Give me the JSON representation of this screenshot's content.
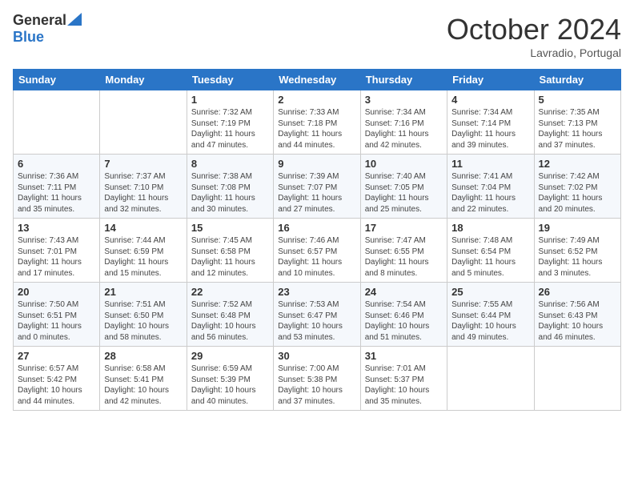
{
  "header": {
    "logo_general": "General",
    "logo_blue": "Blue",
    "month": "October 2024",
    "location": "Lavradio, Portugal"
  },
  "columns": [
    "Sunday",
    "Monday",
    "Tuesday",
    "Wednesday",
    "Thursday",
    "Friday",
    "Saturday"
  ],
  "weeks": [
    [
      {
        "day": "",
        "info": ""
      },
      {
        "day": "",
        "info": ""
      },
      {
        "day": "1",
        "info": "Sunrise: 7:32 AM\nSunset: 7:19 PM\nDaylight: 11 hours and 47 minutes."
      },
      {
        "day": "2",
        "info": "Sunrise: 7:33 AM\nSunset: 7:18 PM\nDaylight: 11 hours and 44 minutes."
      },
      {
        "day": "3",
        "info": "Sunrise: 7:34 AM\nSunset: 7:16 PM\nDaylight: 11 hours and 42 minutes."
      },
      {
        "day": "4",
        "info": "Sunrise: 7:34 AM\nSunset: 7:14 PM\nDaylight: 11 hours and 39 minutes."
      },
      {
        "day": "5",
        "info": "Sunrise: 7:35 AM\nSunset: 7:13 PM\nDaylight: 11 hours and 37 minutes."
      }
    ],
    [
      {
        "day": "6",
        "info": "Sunrise: 7:36 AM\nSunset: 7:11 PM\nDaylight: 11 hours and 35 minutes."
      },
      {
        "day": "7",
        "info": "Sunrise: 7:37 AM\nSunset: 7:10 PM\nDaylight: 11 hours and 32 minutes."
      },
      {
        "day": "8",
        "info": "Sunrise: 7:38 AM\nSunset: 7:08 PM\nDaylight: 11 hours and 30 minutes."
      },
      {
        "day": "9",
        "info": "Sunrise: 7:39 AM\nSunset: 7:07 PM\nDaylight: 11 hours and 27 minutes."
      },
      {
        "day": "10",
        "info": "Sunrise: 7:40 AM\nSunset: 7:05 PM\nDaylight: 11 hours and 25 minutes."
      },
      {
        "day": "11",
        "info": "Sunrise: 7:41 AM\nSunset: 7:04 PM\nDaylight: 11 hours and 22 minutes."
      },
      {
        "day": "12",
        "info": "Sunrise: 7:42 AM\nSunset: 7:02 PM\nDaylight: 11 hours and 20 minutes."
      }
    ],
    [
      {
        "day": "13",
        "info": "Sunrise: 7:43 AM\nSunset: 7:01 PM\nDaylight: 11 hours and 17 minutes."
      },
      {
        "day": "14",
        "info": "Sunrise: 7:44 AM\nSunset: 6:59 PM\nDaylight: 11 hours and 15 minutes."
      },
      {
        "day": "15",
        "info": "Sunrise: 7:45 AM\nSunset: 6:58 PM\nDaylight: 11 hours and 12 minutes."
      },
      {
        "day": "16",
        "info": "Sunrise: 7:46 AM\nSunset: 6:57 PM\nDaylight: 11 hours and 10 minutes."
      },
      {
        "day": "17",
        "info": "Sunrise: 7:47 AM\nSunset: 6:55 PM\nDaylight: 11 hours and 8 minutes."
      },
      {
        "day": "18",
        "info": "Sunrise: 7:48 AM\nSunset: 6:54 PM\nDaylight: 11 hours and 5 minutes."
      },
      {
        "day": "19",
        "info": "Sunrise: 7:49 AM\nSunset: 6:52 PM\nDaylight: 11 hours and 3 minutes."
      }
    ],
    [
      {
        "day": "20",
        "info": "Sunrise: 7:50 AM\nSunset: 6:51 PM\nDaylight: 11 hours and 0 minutes."
      },
      {
        "day": "21",
        "info": "Sunrise: 7:51 AM\nSunset: 6:50 PM\nDaylight: 10 hours and 58 minutes."
      },
      {
        "day": "22",
        "info": "Sunrise: 7:52 AM\nSunset: 6:48 PM\nDaylight: 10 hours and 56 minutes."
      },
      {
        "day": "23",
        "info": "Sunrise: 7:53 AM\nSunset: 6:47 PM\nDaylight: 10 hours and 53 minutes."
      },
      {
        "day": "24",
        "info": "Sunrise: 7:54 AM\nSunset: 6:46 PM\nDaylight: 10 hours and 51 minutes."
      },
      {
        "day": "25",
        "info": "Sunrise: 7:55 AM\nSunset: 6:44 PM\nDaylight: 10 hours and 49 minutes."
      },
      {
        "day": "26",
        "info": "Sunrise: 7:56 AM\nSunset: 6:43 PM\nDaylight: 10 hours and 46 minutes."
      }
    ],
    [
      {
        "day": "27",
        "info": "Sunrise: 6:57 AM\nSunset: 5:42 PM\nDaylight: 10 hours and 44 minutes."
      },
      {
        "day": "28",
        "info": "Sunrise: 6:58 AM\nSunset: 5:41 PM\nDaylight: 10 hours and 42 minutes."
      },
      {
        "day": "29",
        "info": "Sunrise: 6:59 AM\nSunset: 5:39 PM\nDaylight: 10 hours and 40 minutes."
      },
      {
        "day": "30",
        "info": "Sunrise: 7:00 AM\nSunset: 5:38 PM\nDaylight: 10 hours and 37 minutes."
      },
      {
        "day": "31",
        "info": "Sunrise: 7:01 AM\nSunset: 5:37 PM\nDaylight: 10 hours and 35 minutes."
      },
      {
        "day": "",
        "info": ""
      },
      {
        "day": "",
        "info": ""
      }
    ]
  ]
}
